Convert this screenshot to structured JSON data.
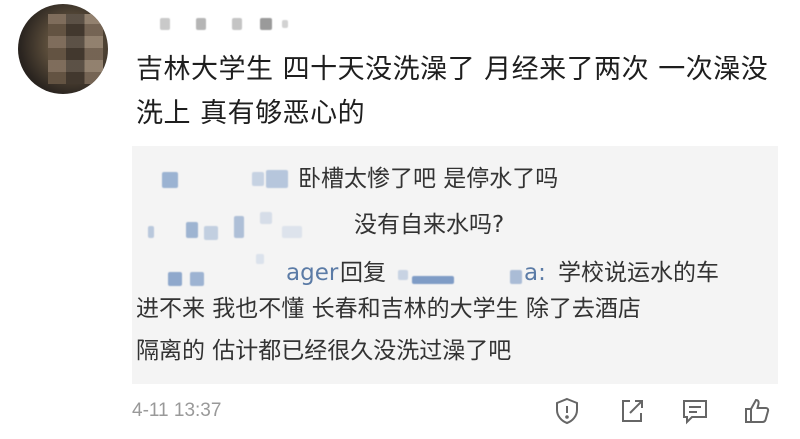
{
  "post": {
    "text": "吉林大学生 四十天没洗澡了 月经来了两次 一次澡没洗上 真有够恶心的",
    "timestamp": "4-11 13:37"
  },
  "replies": [
    {
      "text": "卧槽太惨了吧 是停水了吗"
    },
    {
      "text": "没有自来水吗?"
    },
    {
      "name_suffix": "ager",
      "reply_word": "回复",
      "target_suffix": "a:",
      "text_line1": "学校说运水的车",
      "text_line2": "进不来 我也不懂 长春和吉林的大学生 除了去酒店",
      "text_line3": "隔离的 估计都已经很久没洗过澡了吧"
    }
  ],
  "actions": [
    {
      "icon": "report-shield-icon"
    },
    {
      "icon": "share-icon"
    },
    {
      "icon": "comment-icon"
    },
    {
      "icon": "like-thumb-icon"
    }
  ]
}
